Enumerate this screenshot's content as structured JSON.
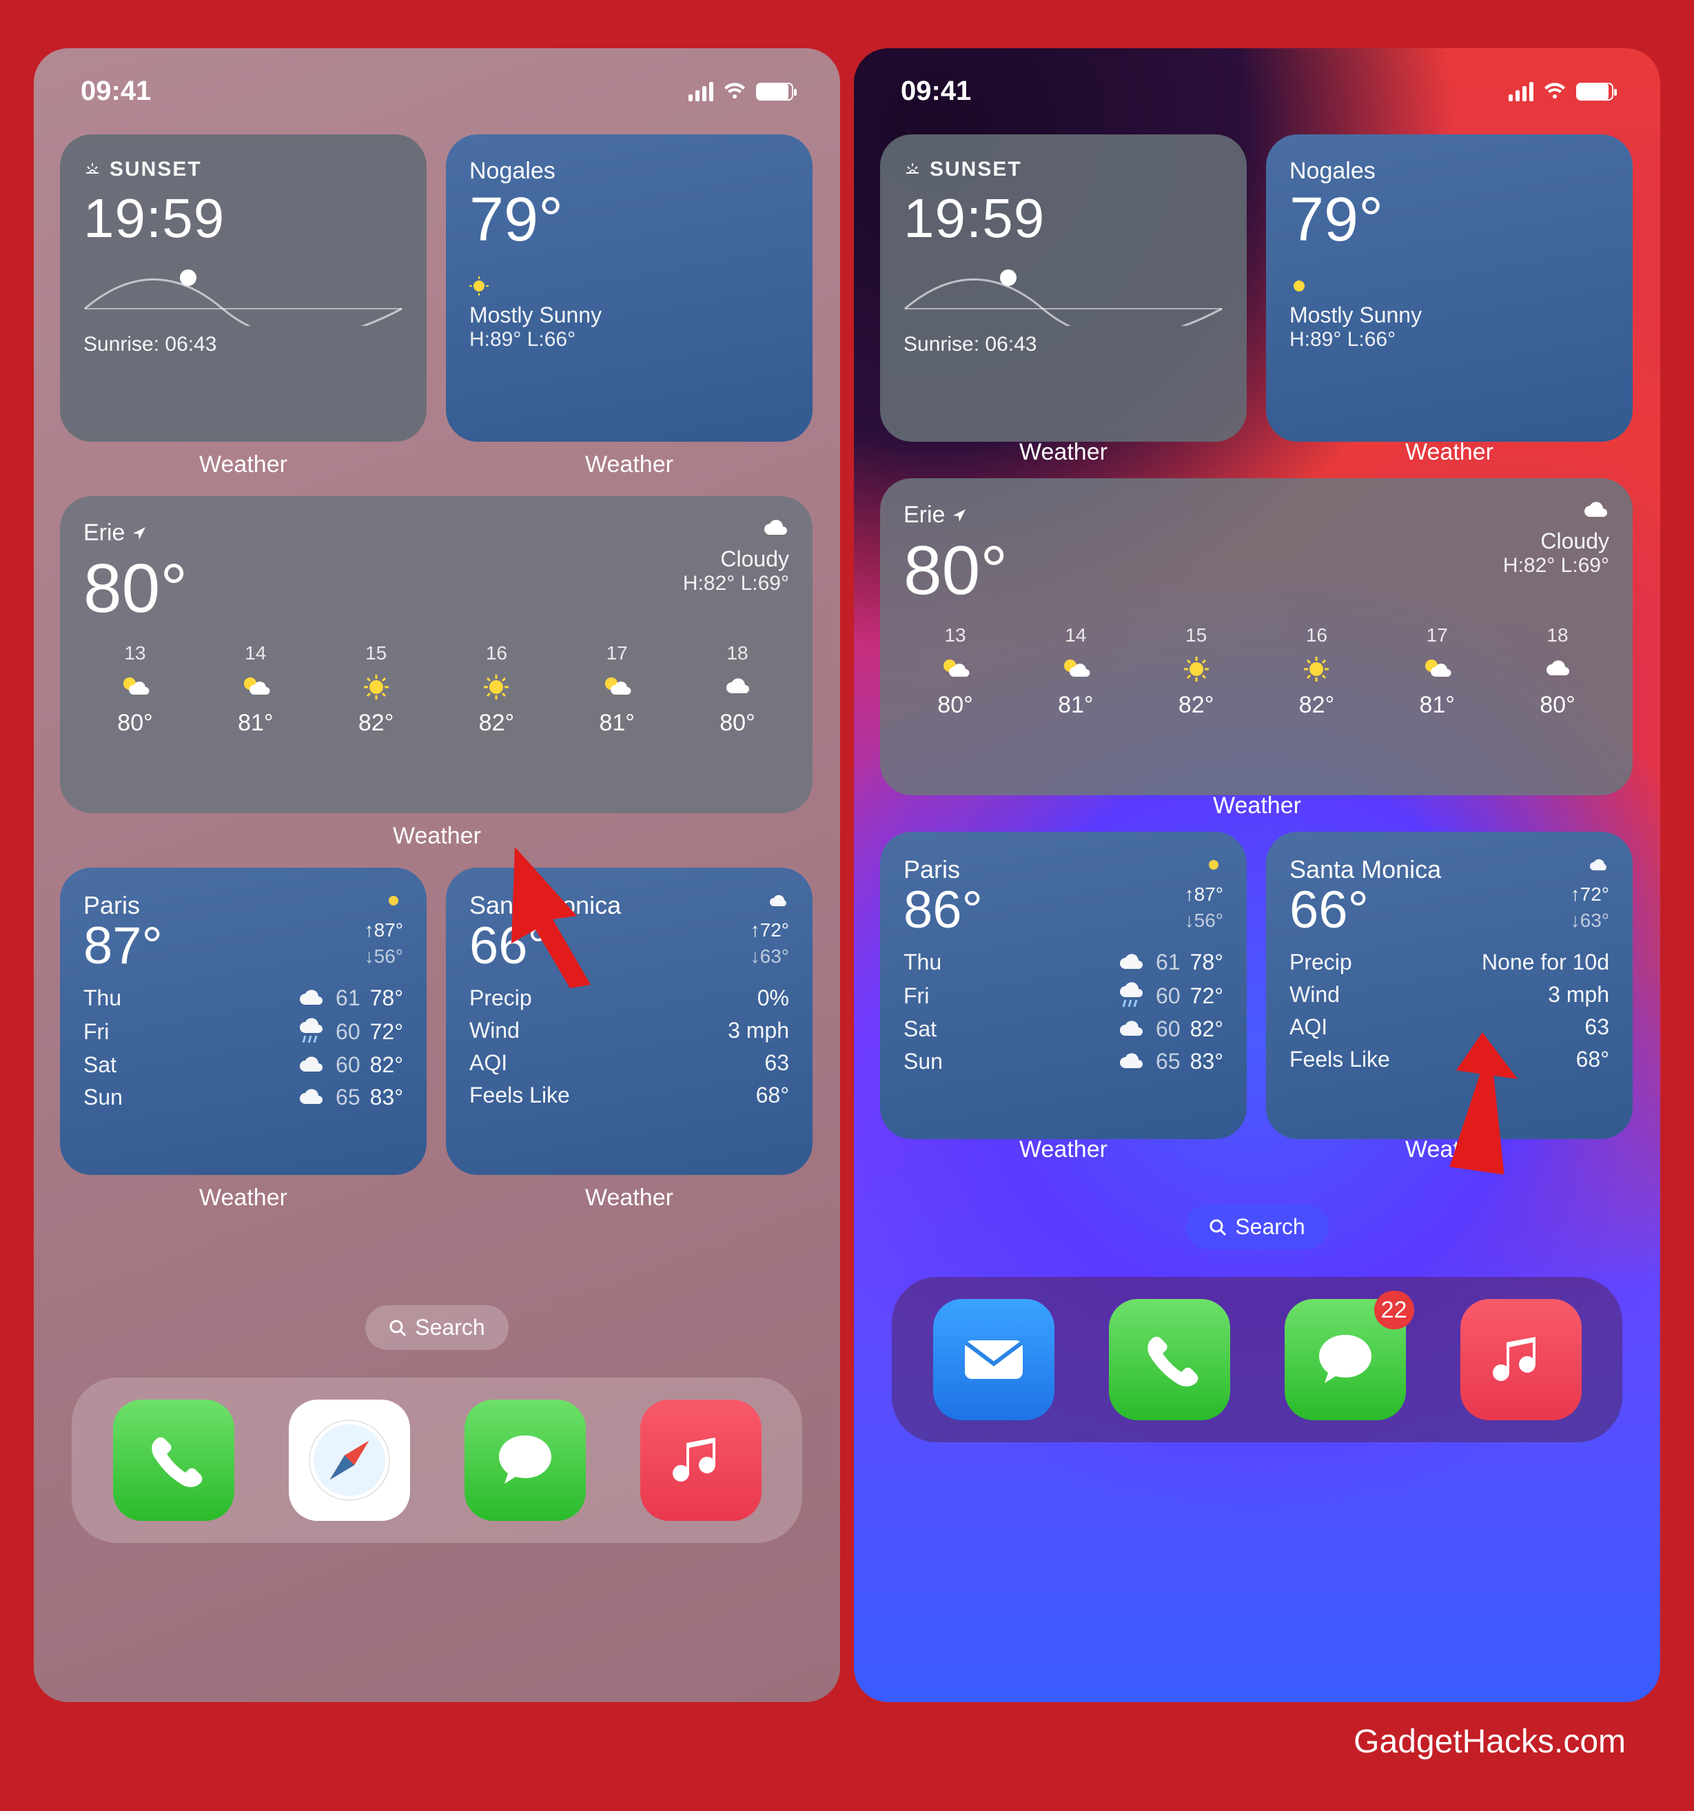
{
  "attribution": "GadgetHacks.com",
  "status": {
    "time": "09:41"
  },
  "widget_caption": "Weather",
  "search_label": "Search",
  "badge_right_messages": "22",
  "left": {
    "sunset": {
      "label": "SUNSET",
      "time": "19:59",
      "sunrise": "Sunrise: 06:43"
    },
    "nogales": {
      "city": "Nogales",
      "temp": "79°",
      "cond": "Mostly Sunny",
      "hilo": "H:89° L:66°"
    },
    "erie": {
      "city": "Erie",
      "temp": "80°",
      "cond": "Cloudy",
      "hilo": "H:82° L:69°",
      "hours": [
        {
          "h": "13",
          "t": "80°",
          "i": "pc"
        },
        {
          "h": "14",
          "t": "81°",
          "i": "pc"
        },
        {
          "h": "15",
          "t": "82°",
          "i": "sun"
        },
        {
          "h": "16",
          "t": "82°",
          "i": "sun"
        },
        {
          "h": "17",
          "t": "81°",
          "i": "pc"
        },
        {
          "h": "18",
          "t": "80°",
          "i": "cloud"
        }
      ]
    },
    "paris": {
      "city": "Paris",
      "temp": "87°",
      "hi": "87°",
      "lo": "56°",
      "days": [
        {
          "d": "Thu",
          "i": "cloud",
          "lo": "61",
          "hi": "78°"
        },
        {
          "d": "Fri",
          "i": "rain",
          "lo": "60",
          "hi": "72°"
        },
        {
          "d": "Sat",
          "i": "cloud",
          "lo": "60",
          "hi": "82°"
        },
        {
          "d": "Sun",
          "i": "cloud",
          "lo": "65",
          "hi": "83°"
        }
      ]
    },
    "santamonica": {
      "city": "Santa Monica",
      "temp": "66°",
      "hi": "72°",
      "lo": "63°",
      "stats": [
        {
          "k": "Precip",
          "v": "0%"
        },
        {
          "k": "Wind",
          "v": "3 mph"
        },
        {
          "k": "AQI",
          "v": "63"
        },
        {
          "k": "Feels Like",
          "v": "68°"
        }
      ]
    }
  },
  "right": {
    "sunset": {
      "label": "SUNSET",
      "time": "19:59",
      "sunrise": "Sunrise: 06:43"
    },
    "nogales": {
      "city": "Nogales",
      "temp": "79°",
      "cond": "Mostly Sunny",
      "hilo": "H:89° L:66°"
    },
    "erie": {
      "city": "Erie",
      "temp": "80°",
      "cond": "Cloudy",
      "hilo": "H:82° L:69°",
      "hours": [
        {
          "h": "13",
          "t": "80°",
          "i": "pc"
        },
        {
          "h": "14",
          "t": "81°",
          "i": "pc"
        },
        {
          "h": "15",
          "t": "82°",
          "i": "sun"
        },
        {
          "h": "16",
          "t": "82°",
          "i": "sun"
        },
        {
          "h": "17",
          "t": "81°",
          "i": "pc"
        },
        {
          "h": "18",
          "t": "80°",
          "i": "cloud"
        }
      ]
    },
    "paris": {
      "city": "Paris",
      "temp": "86°",
      "hi": "87°",
      "lo": "56°",
      "days": [
        {
          "d": "Thu",
          "i": "cloud",
          "lo": "61",
          "hi": "78°"
        },
        {
          "d": "Fri",
          "i": "rain",
          "lo": "60",
          "hi": "72°"
        },
        {
          "d": "Sat",
          "i": "cloud",
          "lo": "60",
          "hi": "82°"
        },
        {
          "d": "Sun",
          "i": "cloud",
          "lo": "65",
          "hi": "83°"
        }
      ]
    },
    "santamonica": {
      "city": "Santa Monica",
      "temp": "66°",
      "hi": "72°",
      "lo": "63°",
      "stats": [
        {
          "k": "Precip",
          "v": "None for 10d"
        },
        {
          "k": "Wind",
          "v": "3 mph"
        },
        {
          "k": "AQI",
          "v": "63"
        },
        {
          "k": "Feels Like",
          "v": "68°"
        }
      ]
    }
  }
}
